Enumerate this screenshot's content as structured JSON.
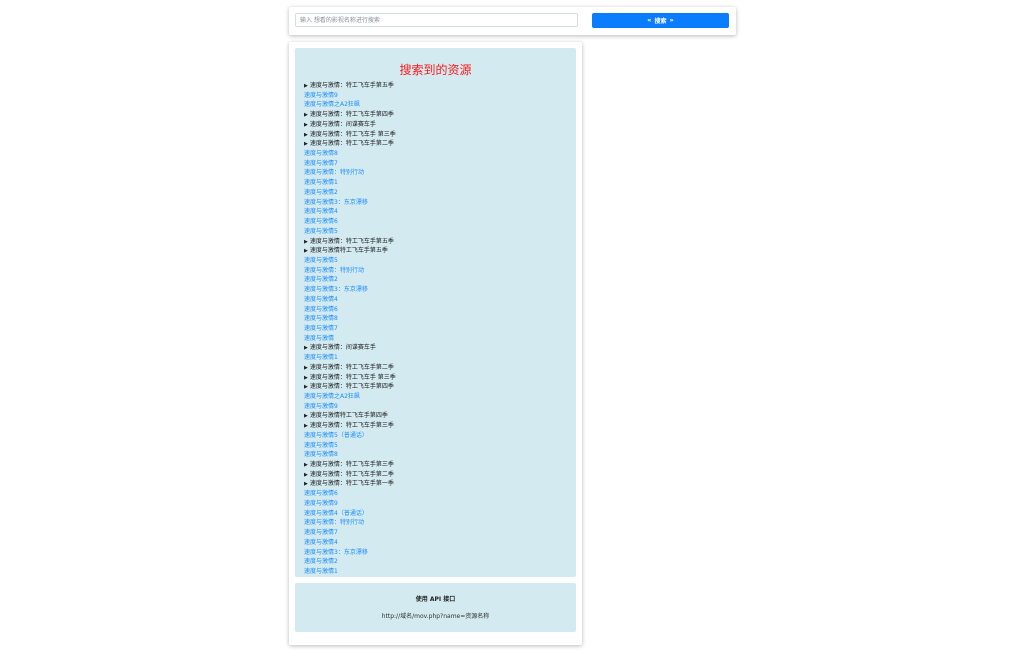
{
  "search": {
    "placeholder": "输入 想看的影视名称进行搜索",
    "value": "",
    "button_label": "搜索"
  },
  "results": {
    "title": "搜索到的资源",
    "items": [
      {
        "type": "folder",
        "label": "速度与激情：特工飞车手第五季"
      },
      {
        "type": "link",
        "label": "速度与激情9"
      },
      {
        "type": "link",
        "label": "速度与激情之A2狂飙"
      },
      {
        "type": "folder",
        "label": "速度与激情：特工飞车手第四季"
      },
      {
        "type": "folder",
        "label": "速度与激情：间谍赛车手"
      },
      {
        "type": "folder",
        "label": "速度与激情：特工飞车手 第三季"
      },
      {
        "type": "folder",
        "label": "速度与激情：特工飞车手第二季"
      },
      {
        "type": "link",
        "label": "速度与激情8"
      },
      {
        "type": "link",
        "label": "速度与激情7"
      },
      {
        "type": "link",
        "label": "速度与激情：特别行动"
      },
      {
        "type": "link",
        "label": "速度与激情1"
      },
      {
        "type": "link",
        "label": "速度与激情2"
      },
      {
        "type": "link",
        "label": "速度与激情3：东京漂移"
      },
      {
        "type": "link",
        "label": "速度与激情4"
      },
      {
        "type": "link",
        "label": "速度与激情6"
      },
      {
        "type": "link",
        "label": "速度与激情5"
      },
      {
        "type": "folder",
        "label": "速度与激情：特工飞车手第五季"
      },
      {
        "type": "folder",
        "label": "速度与激情特工飞车手第五季"
      },
      {
        "type": "link",
        "label": "速度与激情5"
      },
      {
        "type": "link",
        "label": "速度与激情：特别行动"
      },
      {
        "type": "link",
        "label": "速度与激情2"
      },
      {
        "type": "link",
        "label": "速度与激情3：东京漂移"
      },
      {
        "type": "link",
        "label": "速度与激情4"
      },
      {
        "type": "link",
        "label": "速度与激情6"
      },
      {
        "type": "link",
        "label": "速度与激情8"
      },
      {
        "type": "link",
        "label": "速度与激情7"
      },
      {
        "type": "link",
        "label": "速度与激情"
      },
      {
        "type": "folder",
        "label": "速度与激情：间谍赛车手"
      },
      {
        "type": "link",
        "label": "速度与激情1"
      },
      {
        "type": "folder",
        "label": "速度与激情：特工飞车手第二季"
      },
      {
        "type": "folder",
        "label": "速度与激情：特工飞车手 第三季"
      },
      {
        "type": "folder",
        "label": "速度与激情：特工飞车手第四季"
      },
      {
        "type": "link",
        "label": "速度与激情之A2狂飙"
      },
      {
        "type": "link",
        "label": "速度与激情9"
      },
      {
        "type": "folder",
        "label": "速度与激情特工飞车手第四季"
      },
      {
        "type": "folder",
        "label": "速度与激情：特工飞车手第三季"
      },
      {
        "type": "link",
        "label": "速度与激情5（普通话）"
      },
      {
        "type": "link",
        "label": "速度与激情5"
      },
      {
        "type": "link",
        "label": "速度与激情8"
      },
      {
        "type": "folder",
        "label": "速度与激情：特工飞车手第三季"
      },
      {
        "type": "folder",
        "label": "速度与激情：特工飞车手第二季"
      },
      {
        "type": "folder",
        "label": "速度与激情：特工飞车手第一季"
      },
      {
        "type": "link",
        "label": "速度与激情6"
      },
      {
        "type": "link",
        "label": "速度与激情9"
      },
      {
        "type": "link",
        "label": "速度与激情4（普通话）"
      },
      {
        "type": "link",
        "label": "速度与激情：特别行动"
      },
      {
        "type": "link",
        "label": "速度与激情7"
      },
      {
        "type": "link",
        "label": "速度与激情4"
      },
      {
        "type": "link",
        "label": "速度与激情3：东京漂移"
      },
      {
        "type": "link",
        "label": "速度与激情2"
      },
      {
        "type": "link",
        "label": "速度与激情1"
      }
    ]
  },
  "api": {
    "title": "使用 API 接口",
    "url": "http://域名/mov.php?name=资源名称"
  },
  "colors": {
    "accent": "#0a7dff",
    "title": "#ff1a1a",
    "link": "#1c8cff",
    "panel": "#d2eaf0"
  }
}
